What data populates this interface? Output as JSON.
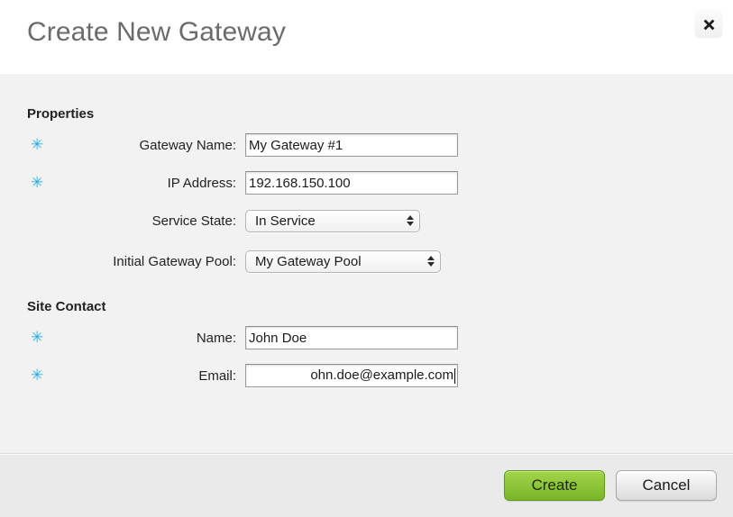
{
  "dialog": {
    "title": "Create New Gateway",
    "close_icon": "close-icon",
    "close_glyph": "✖"
  },
  "sections": {
    "properties": {
      "heading": "Properties",
      "fields": [
        {
          "label": "Gateway Name:",
          "value": "My Gateway #1",
          "required": true,
          "type": "text"
        },
        {
          "label": "IP Address:",
          "value": "192.168.150.100",
          "required": true,
          "type": "text"
        },
        {
          "label": "Service State:",
          "value": "In Service",
          "required": false,
          "type": "select"
        },
        {
          "label": "Initial Gateway Pool:",
          "value": "My Gateway Pool",
          "required": false,
          "type": "select"
        }
      ]
    },
    "site_contact": {
      "heading": "Site Contact",
      "fields": [
        {
          "label": "Name:",
          "value": "John Doe",
          "required": true,
          "type": "text"
        },
        {
          "label": "Email:",
          "value": "ohn.doe@example.com",
          "required": true,
          "type": "text-scrolled"
        }
      ]
    }
  },
  "required_marker": "✳",
  "footer": {
    "create_label": "Create",
    "cancel_label": "Cancel"
  },
  "colors": {
    "accent_required": "#2aabe2",
    "create_button": "#8cc63e",
    "title_text": "#6b6b6b",
    "body_background": "#f2f2f2",
    "footer_background": "#eaeaea"
  }
}
